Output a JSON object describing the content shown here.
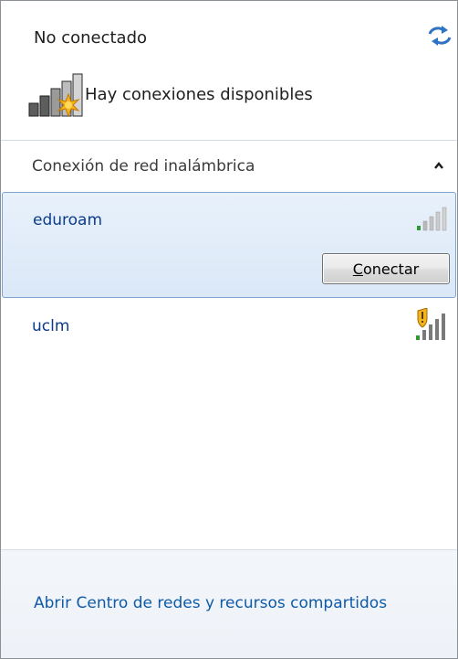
{
  "header": {
    "status": "No conectado",
    "availability": "Hay conexiones disponibles"
  },
  "section": {
    "title": "Conexión de red inalámbrica"
  },
  "networks": [
    {
      "name": "eduroam",
      "button_prefix": "C",
      "button_rest": "onectar",
      "secured_warning": false
    },
    {
      "name": "uclm",
      "secured_warning": true
    }
  ],
  "footer": {
    "link": "Abrir Centro de redes y recursos compartidos"
  },
  "icons": {
    "refresh": "refresh-arrows-icon",
    "availability": "signal-bars-with-star-icon",
    "collapse": "chevron-up-icon",
    "signal": "signal-strength-icon",
    "warning": "shield-warning-icon"
  },
  "colors": {
    "link": "#0e5aa7",
    "network_name": "#0c3c8c",
    "selected_bg": "#dbe8f7",
    "selected_border": "#7da2ce",
    "footer_bg": "#eef2f8"
  }
}
